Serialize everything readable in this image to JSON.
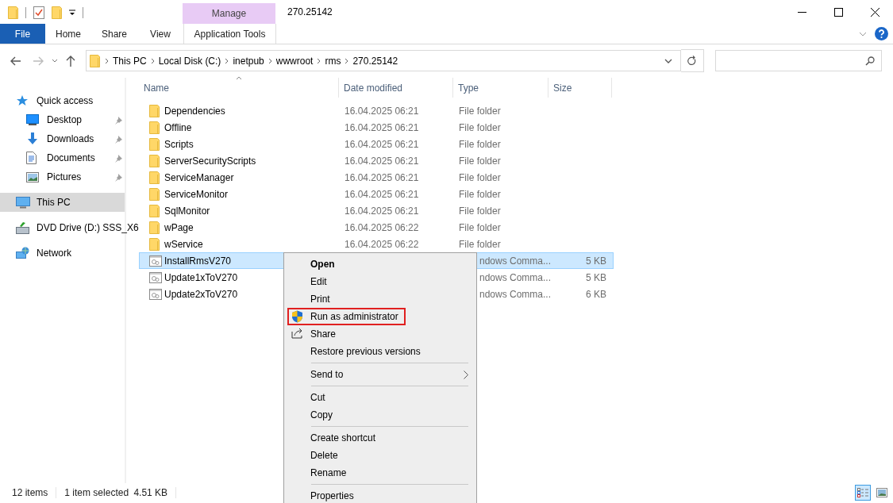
{
  "window": {
    "title": "270.25142"
  },
  "ribbon": {
    "contextual_group": "Manage",
    "tabs": [
      {
        "label": "File",
        "kind": "file",
        "selected": false
      },
      {
        "label": "Home",
        "kind": "normal",
        "selected": false
      },
      {
        "label": "Share",
        "kind": "normal",
        "selected": false
      },
      {
        "label": "View",
        "kind": "normal",
        "selected": false
      },
      {
        "label": "Application Tools",
        "kind": "contextual",
        "selected": false
      }
    ]
  },
  "address_bar": {
    "breadcrumbs": [
      "This PC",
      "Local Disk (C:)",
      "inetpub",
      "wwwroot",
      "rms",
      "270.25142"
    ]
  },
  "navigation": [
    {
      "label": "Quick access",
      "kind": "star",
      "pinned": false,
      "selected": false
    },
    {
      "label": "Desktop",
      "kind": "desktop",
      "pinned": true,
      "selected": false
    },
    {
      "label": "Downloads",
      "kind": "downloads",
      "pinned": true,
      "selected": false
    },
    {
      "label": "Documents",
      "kind": "documents",
      "pinned": true,
      "selected": false
    },
    {
      "label": "Pictures",
      "kind": "pictures",
      "pinned": true,
      "selected": false
    },
    {
      "label": "This PC",
      "kind": "pc",
      "pinned": false,
      "selected": true
    },
    {
      "label": "DVD Drive (D:) SSS_X6",
      "kind": "dvd",
      "pinned": false,
      "selected": false
    },
    {
      "label": "Network",
      "kind": "network",
      "pinned": false,
      "selected": false
    }
  ],
  "table": {
    "columns": [
      "Name",
      "Date modified",
      "Type",
      "Size"
    ],
    "rows": [
      {
        "name": "Dependencies",
        "kind": "folder",
        "date": "16.04.2025 06:21",
        "type": "File folder",
        "selected": false
      },
      {
        "name": "Offline",
        "kind": "folder",
        "date": "16.04.2025 06:21",
        "type": "File folder",
        "selected": false
      },
      {
        "name": "Scripts",
        "kind": "folder",
        "date": "16.04.2025 06:21",
        "type": "File folder",
        "selected": false
      },
      {
        "name": "ServerSecurityScripts",
        "kind": "folder",
        "date": "16.04.2025 06:21",
        "type": "File folder",
        "selected": false
      },
      {
        "name": "ServiceManager",
        "kind": "folder",
        "date": "16.04.2025 06:21",
        "type": "File folder",
        "selected": false
      },
      {
        "name": "ServiceMonitor",
        "kind": "folder",
        "date": "16.04.2025 06:21",
        "type": "File folder",
        "selected": false
      },
      {
        "name": "SqlMonitor",
        "kind": "folder",
        "date": "16.04.2025 06:21",
        "type": "File folder",
        "selected": false
      },
      {
        "name": "wPage",
        "kind": "folder",
        "date": "16.04.2025 06:22",
        "type": "File folder",
        "selected": false
      },
      {
        "name": "wService",
        "kind": "folder",
        "date": "16.04.2025 06:22",
        "type": "File folder",
        "selected": false
      },
      {
        "name": "InstallRmsV270",
        "kind": "script",
        "type": "ndows Comma...",
        "size": "5 KB",
        "selected": true
      },
      {
        "name": "Update1xToV270",
        "kind": "script",
        "type": "ndows Comma...",
        "size": "5 KB",
        "selected": false
      },
      {
        "name": "Update2xToV270",
        "kind": "script",
        "type": "ndows Comma...",
        "size": "6 KB",
        "selected": false
      }
    ]
  },
  "context_menu": [
    {
      "kind": "item",
      "label": "Open",
      "default": true,
      "highlighted": false
    },
    {
      "kind": "item",
      "label": "Edit",
      "default": false,
      "highlighted": false
    },
    {
      "kind": "item",
      "label": "Print",
      "default": false,
      "highlighted": false
    },
    {
      "kind": "shield",
      "label": "Run as administrator",
      "default": false,
      "highlighted": true
    },
    {
      "kind": "share",
      "label": "Share",
      "default": false,
      "highlighted": false
    },
    {
      "kind": "item",
      "label": "Restore previous versions",
      "default": false,
      "highlighted": false
    },
    {
      "kind": "separator"
    },
    {
      "kind": "submenu",
      "label": "Send to",
      "default": false,
      "highlighted": false
    },
    {
      "kind": "separator"
    },
    {
      "kind": "item",
      "label": "Cut",
      "default": false,
      "highlighted": false
    },
    {
      "kind": "item",
      "label": "Copy",
      "default": false,
      "highlighted": false
    },
    {
      "kind": "separator"
    },
    {
      "kind": "item",
      "label": "Create shortcut",
      "default": false,
      "highlighted": false
    },
    {
      "kind": "item",
      "label": "Delete",
      "default": false,
      "highlighted": false
    },
    {
      "kind": "item",
      "label": "Rename",
      "default": false,
      "highlighted": false
    },
    {
      "kind": "separator"
    },
    {
      "kind": "item",
      "label": "Properties",
      "default": false,
      "highlighted": false
    }
  ],
  "status_bar": {
    "item_count": "12 items",
    "selection": "1 item selected",
    "selection_size": "4.51 KB",
    "views": [
      {
        "kind": "details",
        "selected": true
      },
      {
        "kind": "thumbnails",
        "selected": false
      }
    ]
  }
}
